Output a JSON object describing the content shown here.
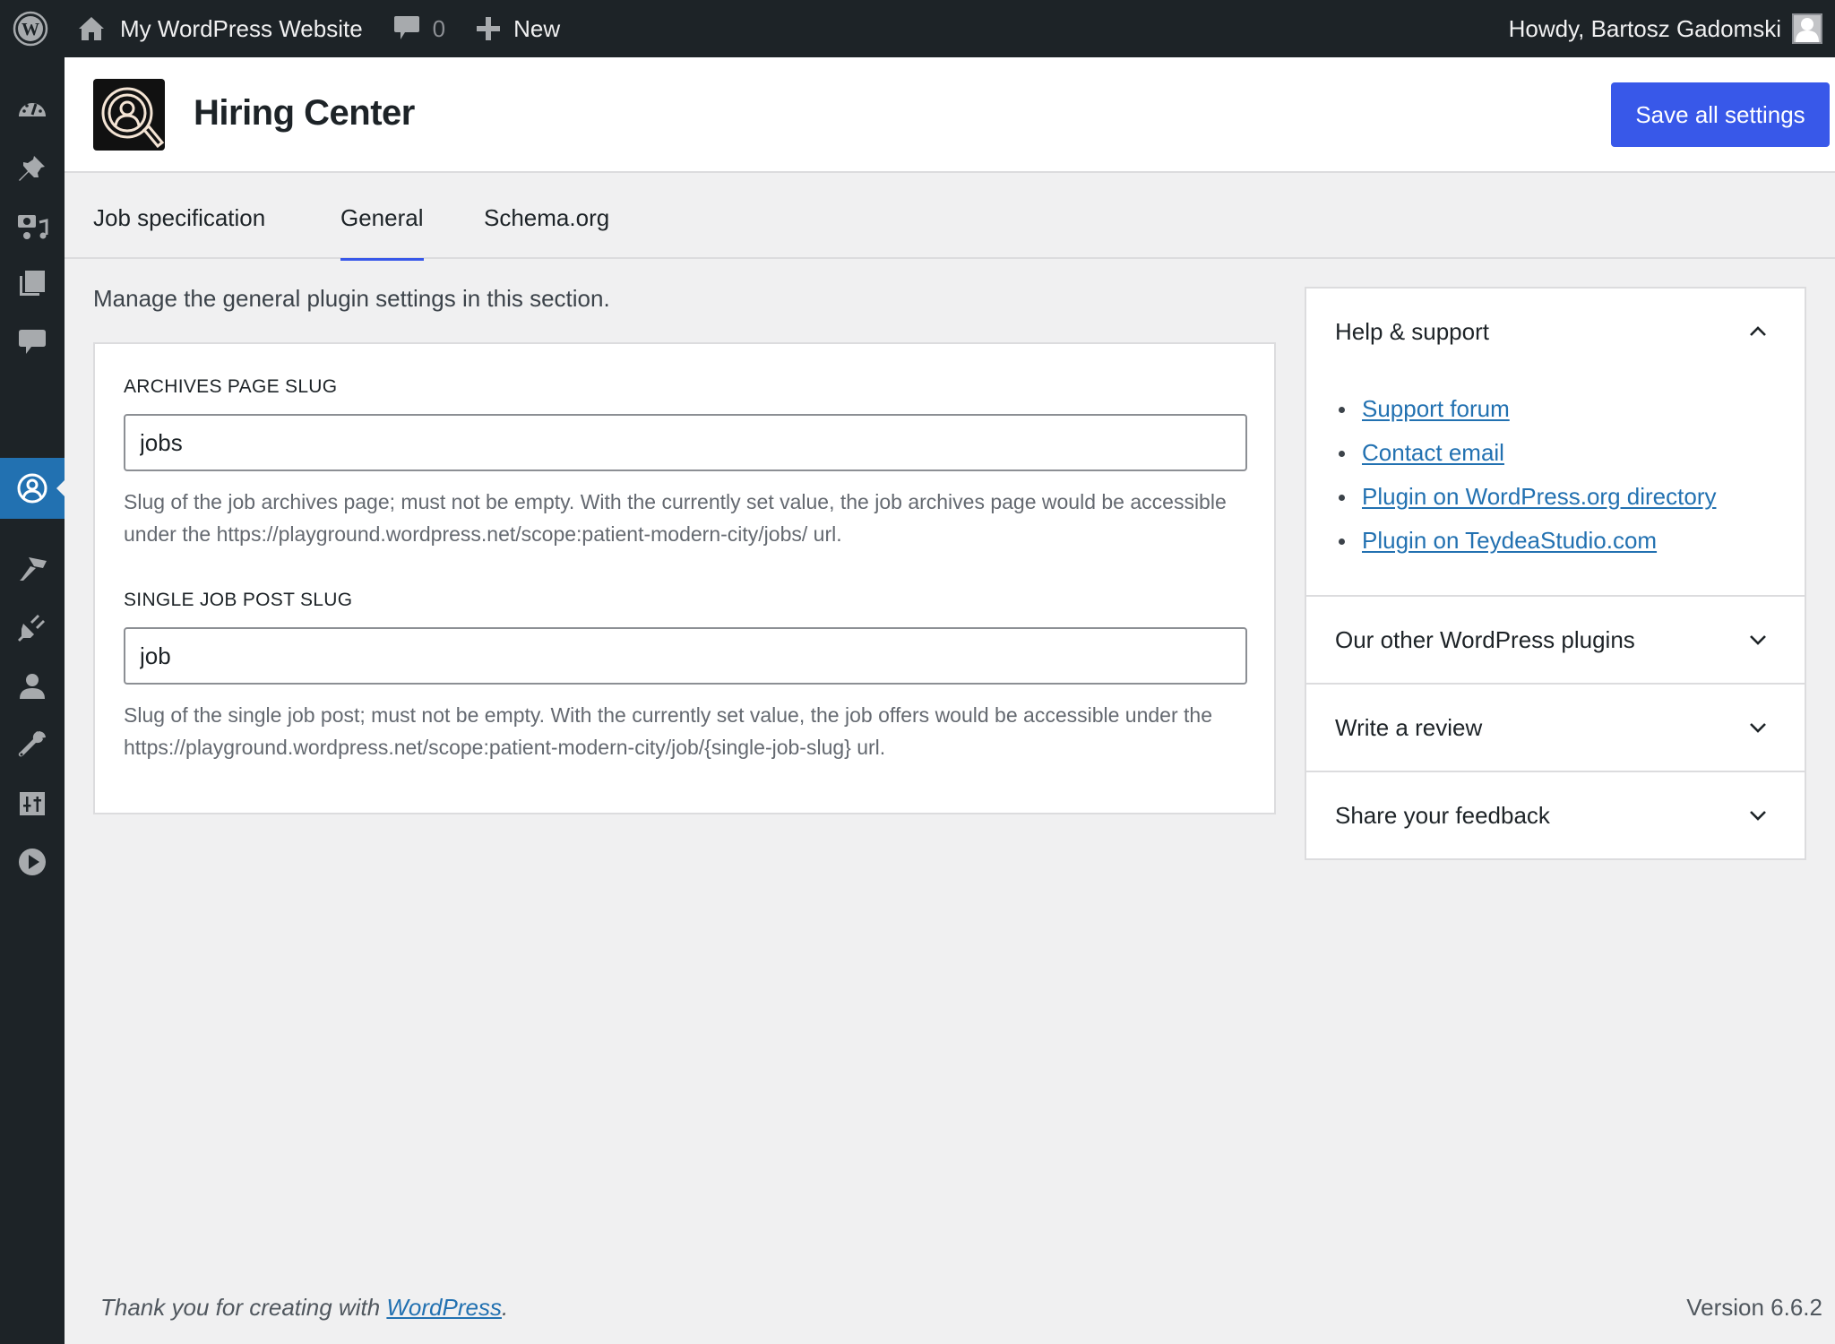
{
  "adminbar": {
    "wp_logo_icon": "wordpress-logo-icon",
    "site_name": "My WordPress Website",
    "comments_count": "0",
    "new_label": "New",
    "greeting": "Howdy, Bartosz Gadomski"
  },
  "sidebar": {
    "items": [
      {
        "name": "dashboard",
        "icon": "dashboard-icon",
        "active": false
      },
      {
        "name": "posts",
        "icon": "pin-icon",
        "active": false
      },
      {
        "name": "media",
        "icon": "media-icon",
        "active": false
      },
      {
        "name": "pages",
        "icon": "pages-icon",
        "active": false
      },
      {
        "name": "comments",
        "icon": "comment-icon",
        "active": false
      },
      {
        "name": "hiring-center",
        "icon": "user-circle-icon",
        "active": true
      },
      {
        "name": "appearance",
        "icon": "brush-icon",
        "active": false
      },
      {
        "name": "plugins",
        "icon": "plugin-icon",
        "active": false
      },
      {
        "name": "users",
        "icon": "user-icon",
        "active": false
      },
      {
        "name": "tools",
        "icon": "wrench-icon",
        "active": false
      },
      {
        "name": "settings",
        "icon": "settings-sliders-icon",
        "active": false
      },
      {
        "name": "media-player",
        "icon": "play-icon",
        "active": false
      }
    ]
  },
  "header": {
    "title": "Hiring Center",
    "save_label": "Save all settings"
  },
  "tabs": [
    {
      "label": "Job specification",
      "active": false
    },
    {
      "label": "General",
      "active": true
    },
    {
      "label": "Schema.org",
      "active": false
    }
  ],
  "main": {
    "intro": "Manage the general plugin settings in this section.",
    "fields": [
      {
        "label": "ARCHIVES PAGE SLUG",
        "value": "jobs",
        "help": "Slug of the job archives page; must not be empty. With the currently set value, the job archives page would be accessible under the https://playground.wordpress.net/scope:patient-modern-city/jobs/ url."
      },
      {
        "label": "SINGLE JOB POST SLUG",
        "value": "job",
        "help": "Slug of the single job post; must not be empty. With the currently set value, the job offers would be accessible under the https://playground.wordpress.net/scope:patient-modern-city/job/{single-job-slug} url."
      }
    ]
  },
  "panel": {
    "sections": [
      {
        "title": "Help & support",
        "open": true,
        "links": [
          "Support forum",
          "Contact email",
          "Plugin on WordPress.org directory",
          "Plugin on TeydeaStudio.com"
        ]
      },
      {
        "title": "Our other WordPress plugins",
        "open": false
      },
      {
        "title": "Write a review",
        "open": false
      },
      {
        "title": "Share your feedback",
        "open": false
      }
    ]
  },
  "footer": {
    "thanks_prefix": "Thank you for creating with ",
    "thanks_link": "WordPress",
    "thanks_suffix": ".",
    "version": "Version 6.6.2"
  },
  "colors": {
    "accent": "#3858e9",
    "admin_dark": "#1d2327",
    "active_menu": "#2271b1",
    "link": "#2271b1"
  }
}
